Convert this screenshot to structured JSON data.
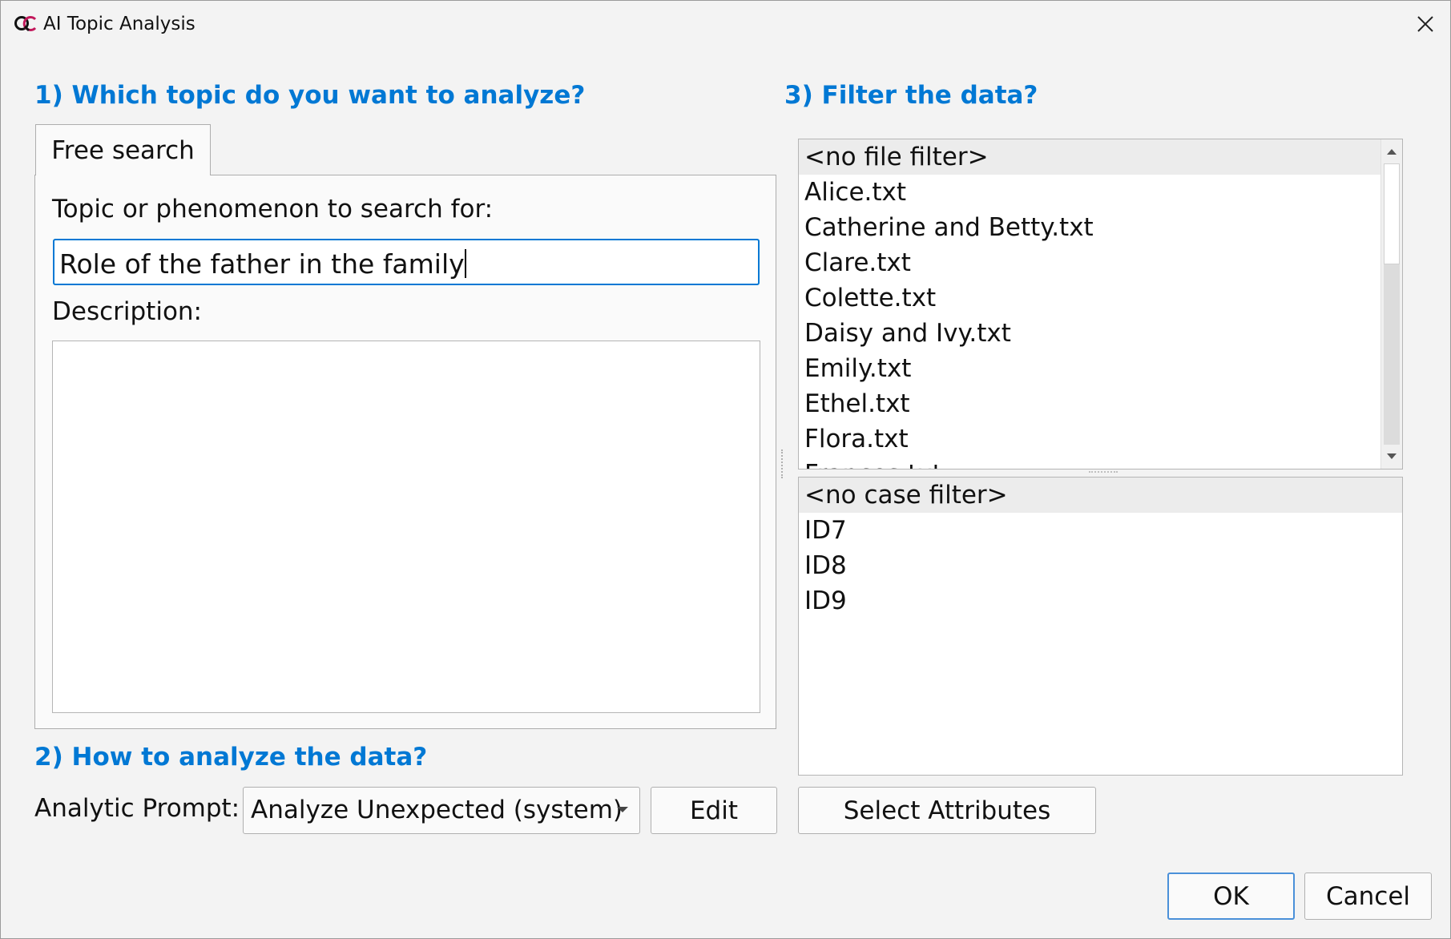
{
  "window": {
    "title": "AI Topic Analysis",
    "icon": "app-logo-icon"
  },
  "section1": {
    "heading": "1) Which topic do you want to analyze?",
    "tab_label": "Free search",
    "topic_label": "Topic or phenomenon to search for:",
    "topic_value": "Role of the father in the family",
    "description_label": "Description:",
    "description_value": ""
  },
  "section2": {
    "heading": "2) How to analyze the data?",
    "prompt_label": "Analytic Prompt:",
    "prompt_selected": "Analyze Unexpected (system)",
    "edit_label": "Edit"
  },
  "section3": {
    "heading": "3) Filter the data?",
    "file_filter": [
      "<no file filter>",
      "Alice.txt",
      "Catherine and Betty.txt",
      "Clare.txt",
      "Colette.txt",
      "Daisy and Ivy.txt",
      "Emily.txt",
      "Ethel.txt",
      "Flora.txt",
      "Frances.txt"
    ],
    "case_filter": [
      "<no case filter>",
      "ID7",
      "ID8",
      "ID9"
    ],
    "select_attributes_label": "Select Attributes"
  },
  "footer": {
    "ok_label": "OK",
    "cancel_label": "Cancel"
  },
  "colors": {
    "heading": "#0078d4",
    "focus_border": "#0078d4",
    "selected_row": "#ececec"
  }
}
